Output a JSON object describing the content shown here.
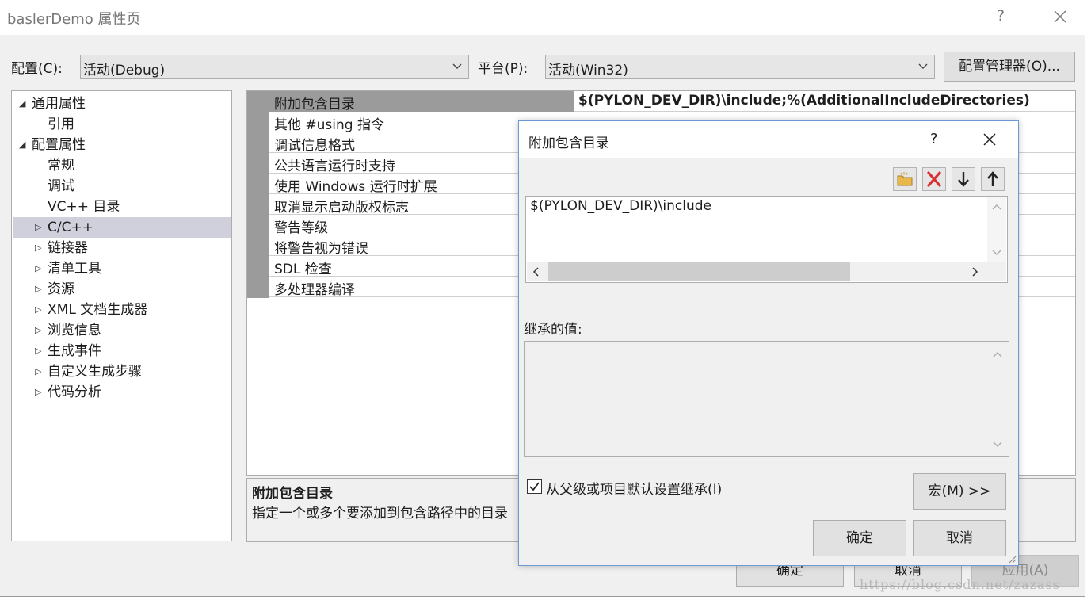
{
  "window": {
    "title": "baslerDemo 属性页",
    "help": "?"
  },
  "config": {
    "config_label": "配置(C):",
    "config_value": "活动(Debug)",
    "platform_label": "平台(P):",
    "platform_value": "活动(Win32)",
    "manager_button": "配置管理器(O)..."
  },
  "tree": {
    "items": [
      {
        "label": "通用属性"
      },
      {
        "label": "引用"
      },
      {
        "label": "配置属性"
      },
      {
        "label": "常规"
      },
      {
        "label": "调试"
      },
      {
        "label": "VC++ 目录"
      },
      {
        "label": "C/C++"
      },
      {
        "label": "链接器"
      },
      {
        "label": "清单工具"
      },
      {
        "label": "资源"
      },
      {
        "label": "XML 文档生成器"
      },
      {
        "label": "浏览信息"
      },
      {
        "label": "生成事件"
      },
      {
        "label": "自定义生成步骤"
      },
      {
        "label": "代码分析"
      }
    ]
  },
  "grid": {
    "rows": [
      {
        "name": "附加包含目录",
        "value": "$(PYLON_DEV_DIR)\\include;%(AdditionalIncludeDirectories)"
      },
      {
        "name": "其他 #using 指令",
        "value": ""
      },
      {
        "name": "调试信息格式",
        "value": ""
      },
      {
        "name": "公共语言运行时支持",
        "value": ""
      },
      {
        "name": "使用 Windows 运行时扩展",
        "value": ""
      },
      {
        "name": "取消显示启动版权标志",
        "value": ""
      },
      {
        "name": "警告等级",
        "value": ""
      },
      {
        "name": "将警告视为错误",
        "value": ""
      },
      {
        "name": "SDL 检查",
        "value": ""
      },
      {
        "name": "多处理器编译",
        "value": ""
      }
    ]
  },
  "description": {
    "title": "附加包含目录",
    "text": "指定一个或多个要添加到包含路径中的目录"
  },
  "bottom_buttons": {
    "ok": "确定",
    "cancel": "取消",
    "apply": "应用(A)"
  },
  "dialog": {
    "title": "附加包含目录",
    "help": "?",
    "entries": [
      "$(PYLON_DEV_DIR)\\include"
    ],
    "inherited_label": "继承的值:",
    "inherit_checkbox_label": "从父级或项目默认设置继承(I)",
    "inherit_checked": true,
    "macro_button": "宏(M) >>",
    "ok_button": "确定",
    "cancel_button": "取消",
    "icon_colors": {
      "folder": "#e8b84a",
      "delete": "#d83030"
    }
  },
  "watermark": "https://blog.csdn.net/zazass"
}
